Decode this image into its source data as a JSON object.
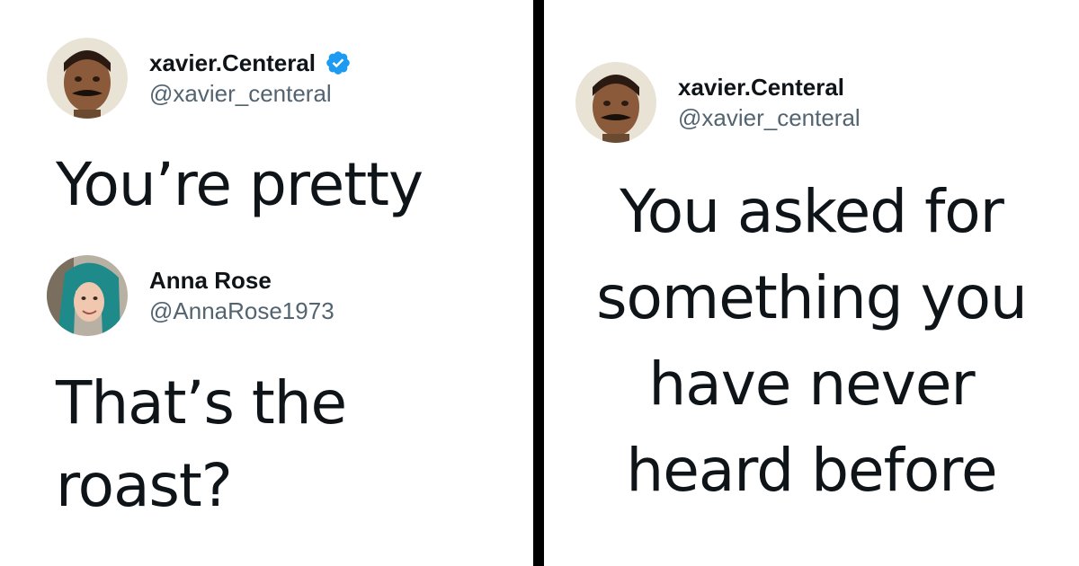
{
  "left_panel": {
    "tweet1": {
      "display_name": "xavier.Centeral",
      "handle": "@xavier_centeral",
      "verified_icon": "verified-badge-icon",
      "text": "You’re pretty"
    },
    "tweet2": {
      "display_name": "Anna Rose",
      "handle": "@AnnaRose1973",
      "text_lines": [
        "That’s the",
        "roast?"
      ]
    }
  },
  "right_panel": {
    "tweet": {
      "display_name": "xavier.Centeral",
      "handle": "@xavier_centeral",
      "text_lines": [
        "You asked for",
        "something you",
        "have never",
        "heard before"
      ]
    }
  },
  "colors": {
    "text": "#0f1419",
    "handle": "#536471",
    "verified": "#1d9bf0",
    "divider": "#000000"
  }
}
